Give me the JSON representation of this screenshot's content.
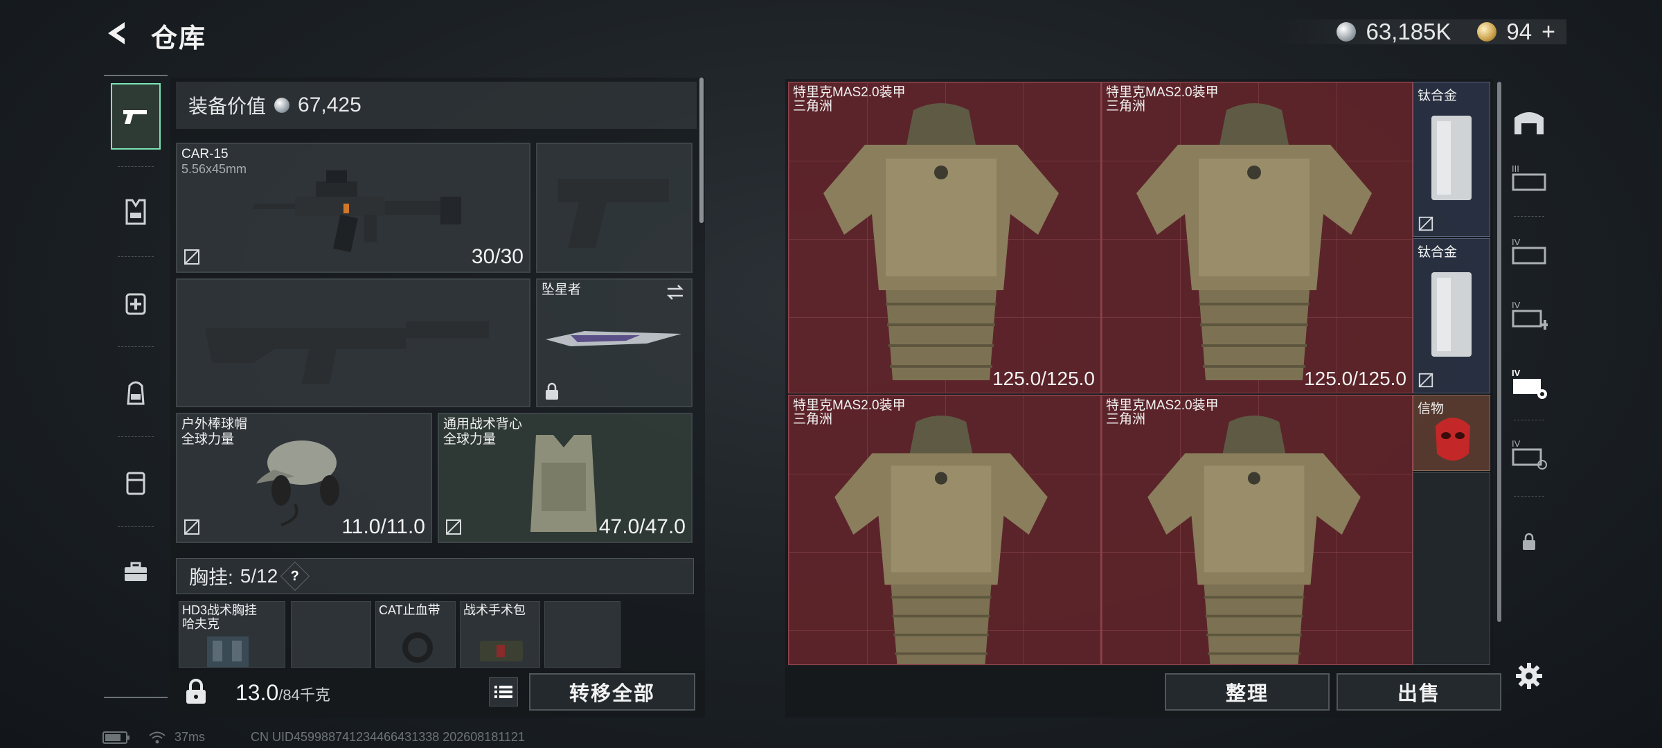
{
  "header": {
    "title": "仓库",
    "silver_amount": "63,185K",
    "gold_amount": "94",
    "gold_plus": "+"
  },
  "equipment": {
    "value_label": "装备价值",
    "value_amount": "67,425",
    "primary_weapon": {
      "name": "CAR-15",
      "caliber": "5.56x45mm",
      "ammo": "30/30"
    },
    "melee": {
      "name": "坠星者"
    },
    "helmet": {
      "name": "户外棒球帽",
      "brand": "全球力量",
      "durability": "11.0/11.0"
    },
    "armor": {
      "name": "通用战术背心",
      "brand": "全球力量",
      "durability": "47.0/47.0"
    },
    "chest_rig": {
      "label": "胸挂:",
      "count": "5/12",
      "help": "?"
    },
    "rig_items": [
      {
        "name": "HD3战术胸挂",
        "sub": "哈夫克"
      },
      {
        "name": ""
      },
      {
        "name": "CAT止血带"
      },
      {
        "name": "战术手术包"
      },
      {
        "name": ""
      }
    ],
    "weight": "13.0",
    "weight_max": "/84千克",
    "transfer_all": "转移全部"
  },
  "stash": {
    "items": [
      {
        "name": "特里克MAS2.0装甲",
        "sub": "三角洲",
        "durability": "125.0/125.0"
      },
      {
        "name": "特里克MAS2.0装甲",
        "sub": "三角洲",
        "durability": "125.0/125.0"
      },
      {
        "name": "特里克MAS2.0装甲",
        "sub": "三角洲",
        "durability": ""
      },
      {
        "name": "特里克MAS2.0装甲",
        "sub": "三角洲",
        "durability": ""
      }
    ],
    "minis": [
      {
        "name": "钛合金"
      },
      {
        "name": "钛合金"
      },
      {
        "name": "信物"
      }
    ],
    "sort_button": "整理",
    "sell_button": "出售"
  },
  "status": {
    "ping": "37ms",
    "uid": "CN UID459988741234466431338 202608181121"
  },
  "colors": {
    "accent": "#7be3b6",
    "stash_cell": "#6e262d",
    "mini_cell": "#2c3446"
  }
}
